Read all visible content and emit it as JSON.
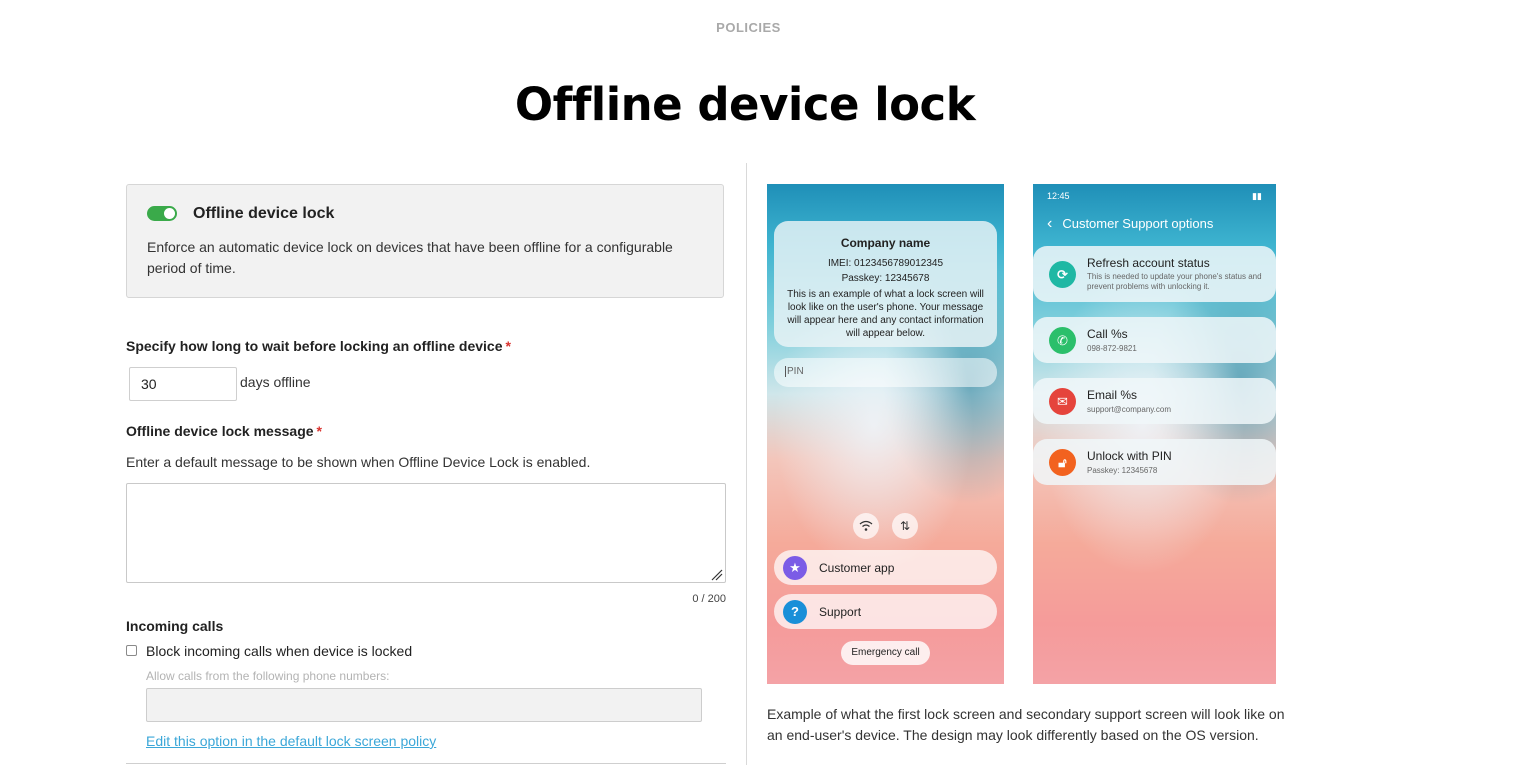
{
  "header": {
    "eyebrow": "POLICIES",
    "title": "Offline device lock"
  },
  "toggle_card": {
    "enabled": true,
    "title": "Offline device lock",
    "description": "Enforce an automatic device lock on devices that have been offline for a configurable period of time."
  },
  "wait": {
    "label": "Specify how long to wait before locking an offline device",
    "required_mark": "*",
    "value": "30",
    "suffix": "days offline"
  },
  "message": {
    "label": "Offline device lock message",
    "required_mark": "*",
    "hint": "Enter a default message to be shown when Offline Device Lock is enabled.",
    "value": "",
    "counter": "0 / 200"
  },
  "incoming_calls": {
    "label": "Incoming calls",
    "checkbox_label": "Block incoming calls when device is locked",
    "checked": false,
    "allow_label": "Allow calls from the following phone numbers:",
    "allow_value": "",
    "edit_link": "Edit this option in the default lock screen policy"
  },
  "preview_lock": {
    "company": "Company name",
    "imei": "IMEI: 0123456789012345",
    "passkey": "Passkey: 12345678",
    "message": "This is an example of what a lock screen will look like on the user's phone. Your message will appear here and any contact information will appear below.",
    "pin_placeholder": "PIN",
    "buttons": [
      {
        "label": "Customer app",
        "icon": "star-icon",
        "color": "#7b5ce6"
      },
      {
        "label": "Support",
        "icon": "question-icon",
        "color": "#1a8fd8"
      }
    ],
    "emergency": "Emergency call"
  },
  "preview_support": {
    "time": "12:45",
    "header": "Customer Support options",
    "options": [
      {
        "title": "Refresh account status",
        "subtitle": "This is needed to update your phone's status and prevent problems with unlocking it.",
        "icon": "refresh-icon",
        "color": "#1fb8a4"
      },
      {
        "title": "Call %s",
        "subtitle": "098-872-9821",
        "icon": "phone-icon",
        "color": "#2bbf6b"
      },
      {
        "title": "Email %s",
        "subtitle": "support@company.com",
        "icon": "mail-icon",
        "color": "#e5443c"
      },
      {
        "title": "Unlock with PIN",
        "subtitle": "Passkey: 12345678",
        "icon": "lock-open-icon",
        "color": "#f2621f"
      }
    ]
  },
  "caption": "Example of what the first lock screen and secondary support screen will look like on an end-user's device. The design may look differently based on the OS version."
}
